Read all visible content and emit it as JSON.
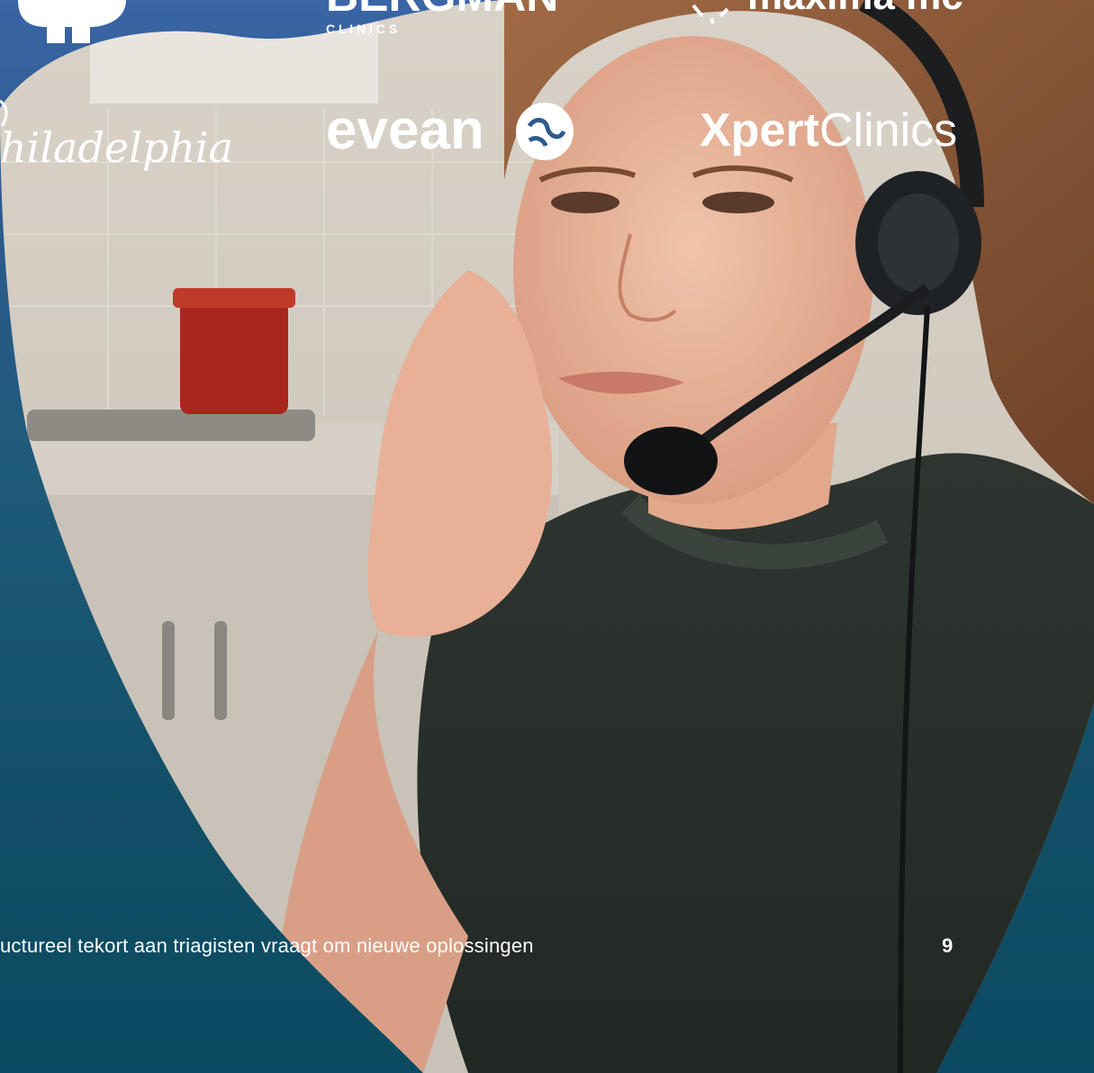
{
  "logos": {
    "bergman_name": "BERGMAN",
    "bergman_sub": "C L I N I C S",
    "maxima": "maxima mc",
    "philadelphia": "hiladelphia",
    "evean": "evean",
    "xpert_bold": "Xpert",
    "xpert_light": "Clinics"
  },
  "footer": {
    "caption": "uctureel tekort aan triagisten vraagt om nieuwe oplossingen",
    "page_number": "9"
  },
  "colors": {
    "background_top": "#3a65a6",
    "background_bottom": "#0b4a60",
    "text": "#ffffff"
  }
}
